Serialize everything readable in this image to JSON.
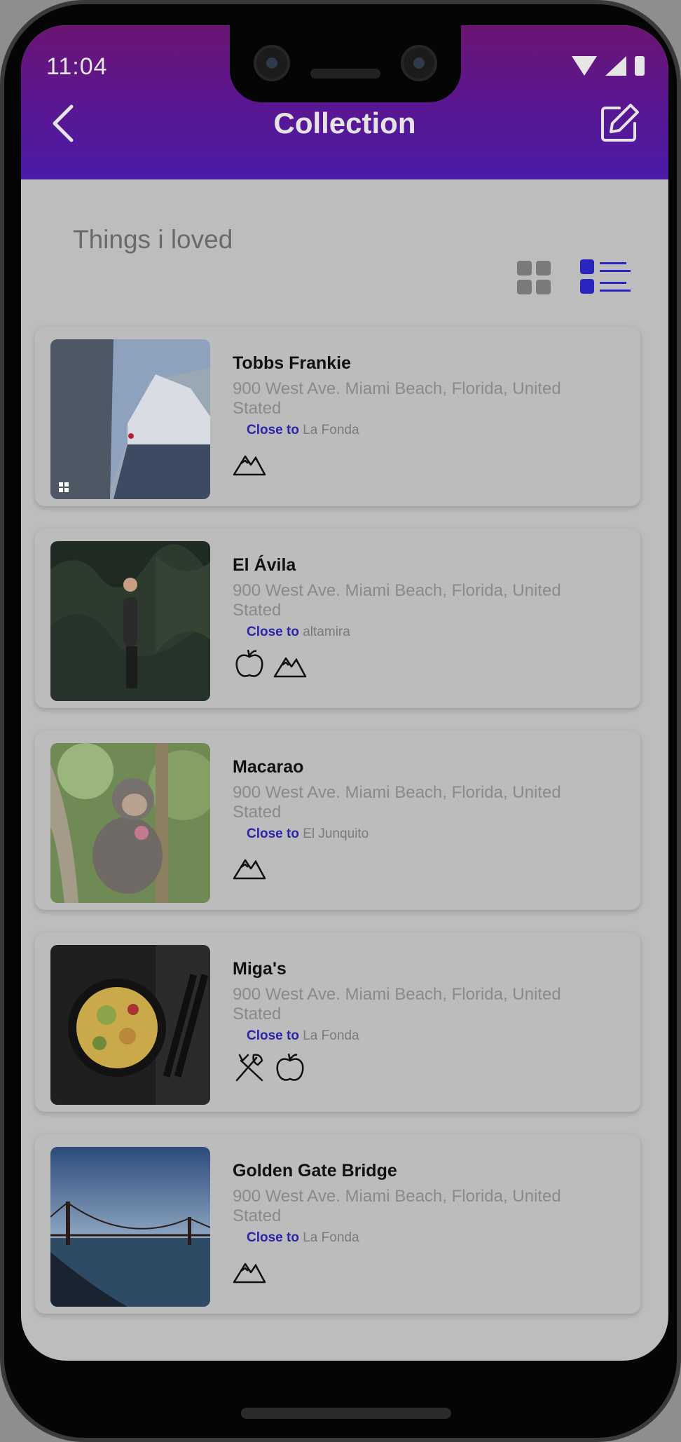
{
  "status_bar": {
    "time": "11:04"
  },
  "app_bar": {
    "title": "Collection"
  },
  "section": {
    "title": "Things i loved"
  },
  "places": [
    {
      "name": "Tobbs Frankie",
      "address": "900 West Ave. Miami Beach, Florida, United Stated",
      "close_to_label": "Close to",
      "close_to": "La Fonda",
      "tags": [
        "mountain-icon"
      ]
    },
    {
      "name": "El Ávila",
      "address": "900 West Ave. Miami Beach, Florida, United Stated",
      "close_to_label": "Close to",
      "close_to": "altamira",
      "tags": [
        "apple-icon",
        "mountain-icon"
      ]
    },
    {
      "name": "Macarao",
      "address": "900 West Ave. Miami Beach, Florida, United Stated",
      "close_to_label": "Close to",
      "close_to": "El Junquito",
      "tags": [
        "mountain-icon"
      ]
    },
    {
      "name": "Miga's",
      "address": "900 West Ave. Miami Beach, Florida, United Stated",
      "close_to_label": "Close to",
      "close_to": "La Fonda",
      "tags": [
        "utensils-icon",
        "apple-icon"
      ]
    },
    {
      "name": "Golden Gate Bridge",
      "address": "900 West Ave. Miami Beach, Florida, United Stated",
      "close_to_label": "Close to",
      "close_to": "La Fonda",
      "tags": [
        "mountain-icon"
      ]
    }
  ],
  "colors": {
    "accent": "#2a25a8",
    "app_bar_top": "#6b1572",
    "app_bar_bottom": "#4b1ba8"
  }
}
